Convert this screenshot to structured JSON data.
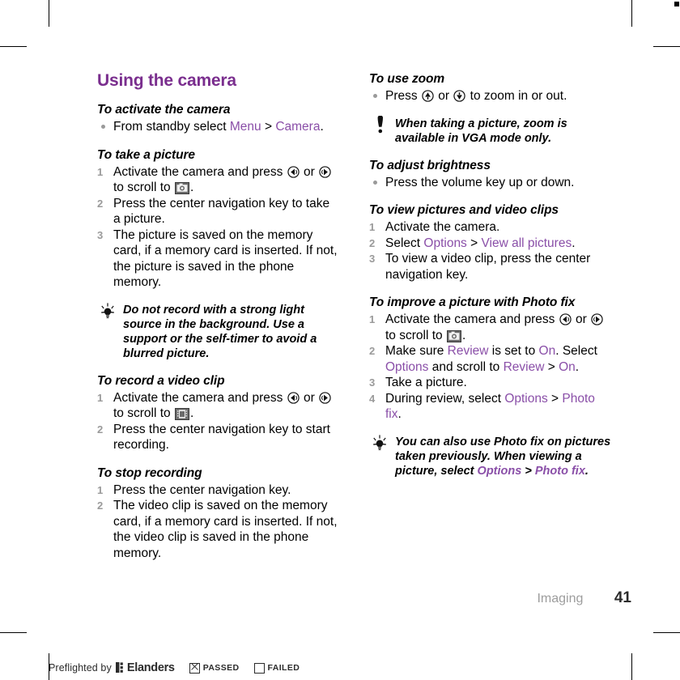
{
  "document": {
    "chapter_heading": "Using the camera",
    "footer_chapter": "Imaging",
    "page_number": "41",
    "accent_color": "#7a2e8e",
    "ui_term_color": "#8a4fa8"
  },
  "preflight": {
    "text": "Preflighted by",
    "brand": "Elanders",
    "passed_label": "PASSED",
    "failed_label": "FAILED",
    "brand_icon": "elanders-logo-icon",
    "passed_icon": "checked-box-icon",
    "failed_icon": "empty-box-icon"
  },
  "left_column": [
    {
      "heading": "To activate the camera",
      "list_type": "bullet",
      "items": [
        {
          "parts": [
            {
              "t": "text",
              "v": "From standby select "
            },
            {
              "t": "ui",
              "v": "Menu"
            },
            {
              "t": "text",
              "v": " > "
            },
            {
              "t": "ui",
              "v": "Camera"
            },
            {
              "t": "text",
              "v": "."
            }
          ]
        }
      ]
    },
    {
      "heading": "To take a picture",
      "list_type": "number",
      "items": [
        {
          "num": "1",
          "parts": [
            {
              "t": "text",
              "v": "Activate the camera and press "
            },
            {
              "t": "icon",
              "v": "nav-left-key-icon"
            },
            {
              "t": "text",
              "v": " or "
            },
            {
              "t": "icon",
              "v": "nav-right-key-icon"
            },
            {
              "t": "text",
              "v": " to scroll to "
            },
            {
              "t": "icon",
              "v": "camera-mode-icon"
            },
            {
              "t": "text",
              "v": "."
            }
          ]
        },
        {
          "num": "2",
          "parts": [
            {
              "t": "text",
              "v": "Press the center navigation key to take a picture."
            }
          ]
        },
        {
          "num": "3",
          "parts": [
            {
              "t": "text",
              "v": "The picture is saved on the memory card, if a memory card is inserted. If not, the picture is saved in the phone memory."
            }
          ]
        }
      ]
    },
    {
      "callout": true,
      "icon": "tip-lightbulb-icon",
      "parts": [
        {
          "t": "text",
          "v": "Do not record with a strong light source in the background. Use a support or the self-timer to avoid a blurred picture."
        }
      ]
    },
    {
      "heading": "To record a video clip",
      "list_type": "number",
      "items": [
        {
          "num": "1",
          "parts": [
            {
              "t": "text",
              "v": "Activate the camera and press "
            },
            {
              "t": "icon",
              "v": "nav-left-key-icon"
            },
            {
              "t": "text",
              "v": " or "
            },
            {
              "t": "icon",
              "v": "nav-right-key-icon"
            },
            {
              "t": "text",
              "v": " to scroll to "
            },
            {
              "t": "icon",
              "v": "video-mode-icon"
            },
            {
              "t": "text",
              "v": "."
            }
          ]
        },
        {
          "num": "2",
          "parts": [
            {
              "t": "text",
              "v": "Press the center navigation key to start recording."
            }
          ]
        }
      ]
    },
    {
      "heading": "To stop recording",
      "list_type": "number",
      "items": [
        {
          "num": "1",
          "parts": [
            {
              "t": "text",
              "v": "Press the center navigation key."
            }
          ]
        },
        {
          "num": "2",
          "parts": [
            {
              "t": "text",
              "v": "The video clip is saved on the memory card, if a memory card is inserted. If not, the video clip is saved in the phone memory."
            }
          ]
        }
      ]
    }
  ],
  "right_column": [
    {
      "heading": "To use zoom",
      "list_type": "bullet",
      "items": [
        {
          "parts": [
            {
              "t": "text",
              "v": "Press "
            },
            {
              "t": "icon",
              "v": "volume-up-key-icon"
            },
            {
              "t": "text",
              "v": " or "
            },
            {
              "t": "icon",
              "v": "volume-down-key-icon"
            },
            {
              "t": "text",
              "v": " to zoom in or out."
            }
          ]
        }
      ]
    },
    {
      "callout": true,
      "icon": "note-exclamation-icon",
      "parts": [
        {
          "t": "text",
          "v": "When taking a picture, zoom is available in VGA mode only."
        }
      ]
    },
    {
      "heading": "To adjust brightness",
      "list_type": "bullet",
      "items": [
        {
          "parts": [
            {
              "t": "text",
              "v": "Press the volume key up or down."
            }
          ]
        }
      ]
    },
    {
      "heading": "To view pictures and video clips",
      "list_type": "number",
      "items": [
        {
          "num": "1",
          "parts": [
            {
              "t": "text",
              "v": "Activate the camera."
            }
          ]
        },
        {
          "num": "2",
          "parts": [
            {
              "t": "text",
              "v": "Select "
            },
            {
              "t": "ui",
              "v": "Options"
            },
            {
              "t": "text",
              "v": " > "
            },
            {
              "t": "ui",
              "v": "View all pictures"
            },
            {
              "t": "text",
              "v": "."
            }
          ]
        },
        {
          "num": "3",
          "parts": [
            {
              "t": "text",
              "v": "To view a video clip, press the center navigation key."
            }
          ]
        }
      ]
    },
    {
      "heading": "To improve a picture with Photo fix",
      "list_type": "number",
      "items": [
        {
          "num": "1",
          "parts": [
            {
              "t": "text",
              "v": "Activate the camera and press "
            },
            {
              "t": "icon",
              "v": "nav-left-key-icon"
            },
            {
              "t": "text",
              "v": " or "
            },
            {
              "t": "icon",
              "v": "nav-right-key-icon"
            },
            {
              "t": "text",
              "v": " to scroll to "
            },
            {
              "t": "icon",
              "v": "camera-mode-icon"
            },
            {
              "t": "text",
              "v": "."
            }
          ]
        },
        {
          "num": "2",
          "parts": [
            {
              "t": "text",
              "v": "Make sure "
            },
            {
              "t": "ui",
              "v": "Review"
            },
            {
              "t": "text",
              "v": " is set to "
            },
            {
              "t": "ui",
              "v": "On"
            },
            {
              "t": "text",
              "v": ". Select "
            },
            {
              "t": "ui",
              "v": "Options"
            },
            {
              "t": "text",
              "v": " and scroll to "
            },
            {
              "t": "ui",
              "v": "Review"
            },
            {
              "t": "text",
              "v": " > "
            },
            {
              "t": "ui",
              "v": "On"
            },
            {
              "t": "text",
              "v": "."
            }
          ]
        },
        {
          "num": "3",
          "parts": [
            {
              "t": "text",
              "v": "Take a picture."
            }
          ]
        },
        {
          "num": "4",
          "parts": [
            {
              "t": "text",
              "v": "During review, select "
            },
            {
              "t": "ui",
              "v": "Options"
            },
            {
              "t": "text",
              "v": " > "
            },
            {
              "t": "ui",
              "v": "Photo fix"
            },
            {
              "t": "text",
              "v": "."
            }
          ]
        }
      ]
    },
    {
      "callout": true,
      "icon": "tip-lightbulb-icon",
      "parts": [
        {
          "t": "text",
          "v": "You can also use Photo fix on pictures taken previously. When viewing a picture, select "
        },
        {
          "t": "ui",
          "v": "Options"
        },
        {
          "t": "text",
          "v": " > "
        },
        {
          "t": "ui",
          "v": "Photo fix"
        },
        {
          "t": "text",
          "v": "."
        }
      ]
    }
  ]
}
